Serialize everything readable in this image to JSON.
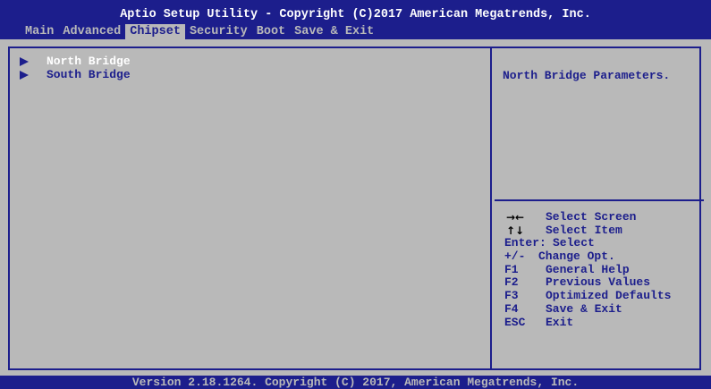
{
  "title": "Aptio Setup Utility - Copyright (C)2017 American Megatrends, Inc.",
  "tabs": [
    {
      "label": "Main"
    },
    {
      "label": "Advanced"
    },
    {
      "label": "Chipset",
      "active": true
    },
    {
      "label": "Security"
    },
    {
      "label": "Boot"
    },
    {
      "label": "Save & Exit"
    }
  ],
  "menu": {
    "items": [
      {
        "label": "North Bridge",
        "selected": true
      },
      {
        "label": "South Bridge",
        "selected": false
      }
    ]
  },
  "help": {
    "text": "North Bridge Parameters."
  },
  "keys": [
    {
      "icon": "left-right-arrow-icon",
      "glyph": "→←",
      "desc": "Select Screen"
    },
    {
      "icon": "up-down-arrow-icon",
      "glyph": "↑↓",
      "desc": "Select Item"
    },
    {
      "key": "Enter:",
      "desc": "Select"
    },
    {
      "key": "+/-",
      "desc": "Change Opt."
    },
    {
      "key": "F1",
      "desc": "General Help"
    },
    {
      "key": "F2",
      "desc": "Previous Values"
    },
    {
      "key": "F3",
      "desc": "Optimized Defaults"
    },
    {
      "key": "F4",
      "desc": "Save & Exit"
    },
    {
      "key": "ESC",
      "desc": "Exit"
    }
  ],
  "footer": "Version 2.18.1264. Copyright (C) 2017, American Megatrends, Inc.",
  "colors": {
    "bar": "#1c1e8c",
    "panel": "#b9b9b9",
    "selected_text": "#ffffff"
  }
}
